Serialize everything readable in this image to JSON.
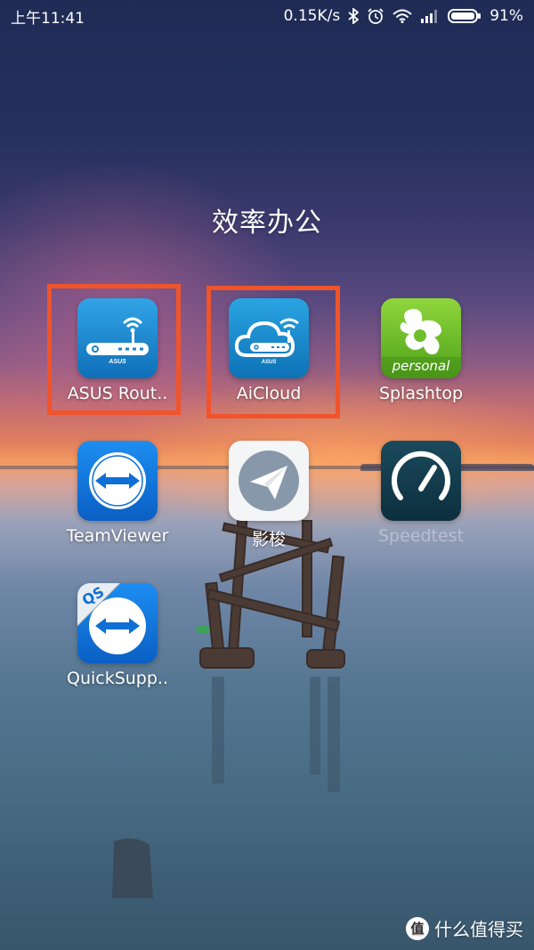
{
  "status_bar": {
    "time": "上午11:41",
    "network_speed": "0.15K/s",
    "battery": "91%",
    "icons": [
      "bluetooth-icon",
      "alarm-icon",
      "wifi-icon",
      "signal-icon",
      "battery-icon"
    ]
  },
  "folder": {
    "title": "效率办公"
  },
  "apps": [
    {
      "label": "ASUS Rout..",
      "icon": "asus-router-icon",
      "highlighted": true
    },
    {
      "label": "AiCloud",
      "icon": "aicloud-icon",
      "highlighted": true
    },
    {
      "label": "Splashtop",
      "icon": "splashtop-icon",
      "icon_text": "personal",
      "highlighted": false
    },
    {
      "label": "TeamViewer",
      "icon": "teamviewer-icon",
      "highlighted": false
    },
    {
      "label": "影梭",
      "icon": "paper-plane-icon",
      "highlighted": false
    },
    {
      "label": "Speedtest",
      "icon": "speedtest-icon",
      "highlighted": false
    },
    {
      "label": "QuickSupp..",
      "icon": "quicksupport-icon",
      "icon_text": "QS",
      "highlighted": false
    }
  ],
  "router_brand": "ASUS",
  "highlight_color": "#f0542a",
  "watermark": {
    "badge": "值",
    "text": "什么值得买"
  }
}
